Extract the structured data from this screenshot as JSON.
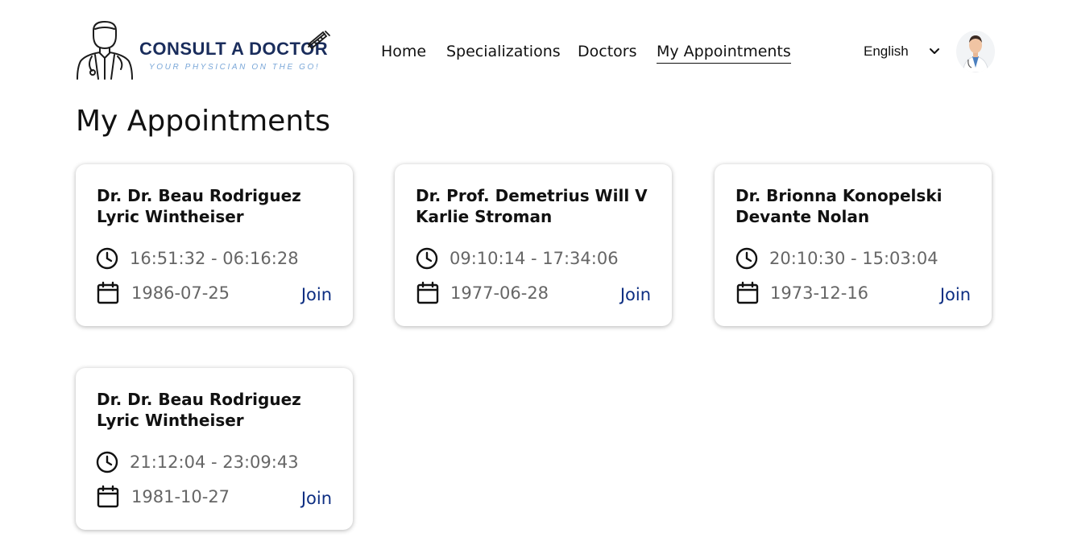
{
  "logo": {
    "title": "CONSULT A DOCTOR",
    "tagline": "YOUR PHYSICIAN ON THE GO!",
    "icon": "doctor-figure-icon"
  },
  "nav": {
    "items": [
      {
        "label": "Home"
      },
      {
        "label": "Specializations"
      },
      {
        "label": "Doctors"
      },
      {
        "label": "My Appointments",
        "active": true
      }
    ]
  },
  "language": {
    "selected": "English",
    "icon": "chevron-down-icon"
  },
  "user": {
    "avatar_icon": "avatar"
  },
  "page": {
    "title": "My Appointments"
  },
  "appointments": [
    {
      "doctor_line1": "Dr. Dr. Beau Rodriguez",
      "doctor_line2": "Lyric Wintheiser",
      "time_range": "16:51:32 - 06:16:28",
      "date": "1986-07-25",
      "join_label": "Join"
    },
    {
      "doctor_line1": "Dr. Prof. Demetrius Will V",
      "doctor_line2": "Karlie Stroman",
      "time_range": "09:10:14 - 17:34:06",
      "date": "1977-06-28",
      "join_label": "Join"
    },
    {
      "doctor_line1": "Dr. Brionna Konopelski",
      "doctor_line2": "Devante Nolan",
      "time_range": "20:10:30 - 15:03:04",
      "date": "1973-12-16",
      "join_label": "Join"
    },
    {
      "doctor_line1": "Dr. Dr. Beau Rodriguez",
      "doctor_line2": "Lyric Wintheiser",
      "time_range": "21:12:04 - 23:09:43",
      "date": "1981-10-27",
      "join_label": "Join"
    }
  ],
  "colors": {
    "join": "#0d2e82",
    "logo_title": "#1a2d5c",
    "logo_tagline": "#7aa7d8",
    "muted_text": "#666666"
  }
}
